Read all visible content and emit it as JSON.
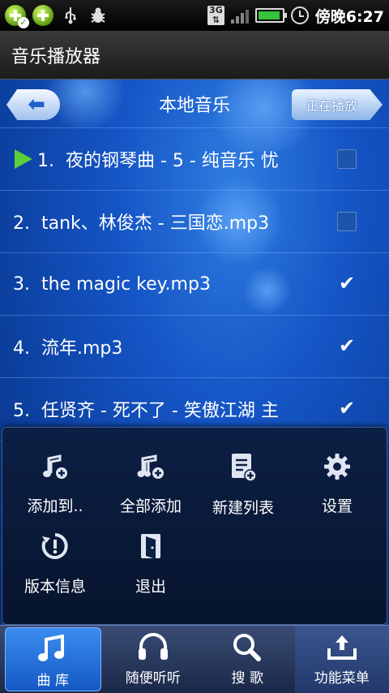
{
  "status_bar": {
    "network": "3G",
    "time": "傍晚6:27",
    "battery_level": 0.95
  },
  "app": {
    "title": "音乐播放器"
  },
  "nav": {
    "title": "本地音乐",
    "now_playing_label": "正在播放"
  },
  "songs": [
    {
      "num": "1.",
      "title": "夜的钢琴曲 - 5 - 纯音乐 忧",
      "checked": false,
      "playing": true
    },
    {
      "num": "2.",
      "title": "tank、林俊杰 - 三国恋.mp3",
      "checked": false,
      "playing": false
    },
    {
      "num": "3.",
      "title": "the magic key.mp3",
      "checked": true,
      "playing": false
    },
    {
      "num": "4.",
      "title": "流年.mp3",
      "checked": true,
      "playing": false
    },
    {
      "num": "5.",
      "title": "任贤齐 - 死不了 - 笑傲江湖 主",
      "checked": true,
      "playing": false
    }
  ],
  "menu": {
    "items": [
      {
        "label": "添加到..",
        "icon": "add-to-icon"
      },
      {
        "label": "全部添加",
        "icon": "add-all-icon"
      },
      {
        "label": "新建列表",
        "icon": "new-list-icon"
      },
      {
        "label": "设置",
        "icon": "gear-icon"
      },
      {
        "label": "版本信息",
        "icon": "version-info-icon"
      },
      {
        "label": "退出",
        "icon": "exit-icon"
      }
    ]
  },
  "tabs": [
    {
      "label": "曲 库",
      "icon": "music-note-icon",
      "active": true
    },
    {
      "label": "随便听听",
      "icon": "headphones-icon",
      "active": false
    },
    {
      "label": "搜 歌",
      "icon": "search-icon",
      "active": false
    },
    {
      "label": "功能菜单",
      "icon": "menu-upload-icon",
      "active": false
    }
  ],
  "colors": {
    "accent": "#1f62c9",
    "play_indicator": "#5ccf3a",
    "battery": "#36c23a"
  }
}
